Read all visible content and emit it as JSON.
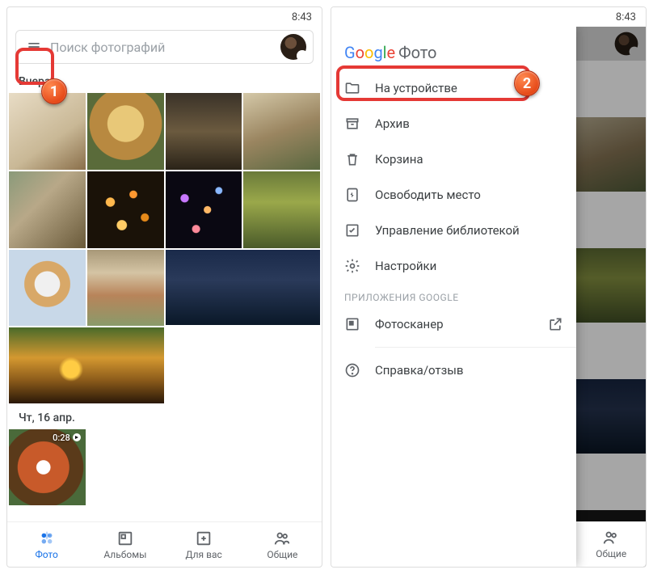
{
  "status": {
    "time": "8:43"
  },
  "left": {
    "search_placeholder": "Поиск фотографий",
    "sections": [
      {
        "label": "Вчера"
      },
      {
        "label": "Чт, 16 апр."
      }
    ],
    "video_duration": "0:28",
    "nav": [
      {
        "label": "Фото"
      },
      {
        "label": "Альбомы"
      },
      {
        "label": "Для вас"
      },
      {
        "label": "Общие"
      }
    ]
  },
  "right": {
    "brand_suffix": "Фото",
    "menu": [
      {
        "label": "На устройстве"
      },
      {
        "label": "Архив"
      },
      {
        "label": "Корзина"
      },
      {
        "label": "Освободить место"
      },
      {
        "label": "Управление библиотекой"
      },
      {
        "label": "Настройки"
      }
    ],
    "apps_header": "ПРИЛОЖЕНИЯ GOOGLE",
    "apps": [
      {
        "label": "Фотосканер"
      }
    ],
    "help": {
      "label": "Справка/отзыв"
    },
    "bg_nav_label": "Общие"
  },
  "callouts": {
    "one": "1",
    "two": "2"
  }
}
